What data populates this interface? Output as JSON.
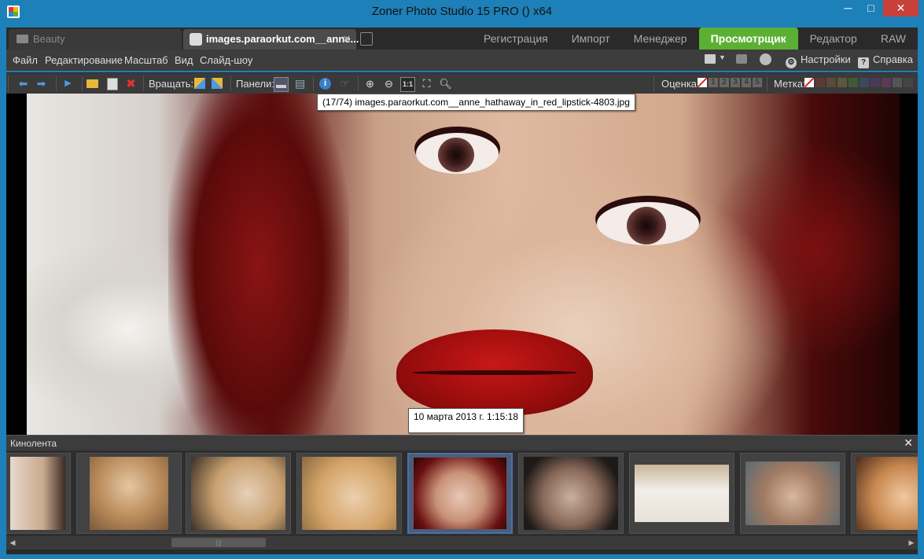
{
  "window": {
    "title": "Zoner Photo Studio 15 PRO  () x64",
    "minimize": "─",
    "maximize": "□",
    "close": "✕"
  },
  "doc_tabs": [
    {
      "label": "Beauty",
      "icon": "folder-icon"
    },
    {
      "label": "images.paraorkut.com__anne...",
      "icon": "viewer-icon",
      "close": "✕"
    }
  ],
  "mode_tabs": [
    {
      "label": "Регистрация",
      "active": false
    },
    {
      "label": "Импорт",
      "active": false
    },
    {
      "label": "Менеджер",
      "active": false
    },
    {
      "label": "Просмотрщик",
      "active": true
    },
    {
      "label": "Редактор",
      "active": false
    },
    {
      "label": "RAW",
      "active": false
    }
  ],
  "menu": [
    "Файл",
    "Редактирование",
    "Масштаб",
    "Вид",
    "Слайд-шоу"
  ],
  "menu_right": {
    "settings": "Настройки",
    "help": "Справка"
  },
  "toolbar": {
    "rotate_label": "Вращать:",
    "panels_label": "Панели:",
    "rating_label": "Оценка:",
    "rating_values": [
      "1",
      "2",
      "3",
      "4",
      "5"
    ],
    "label_label": "Метка:",
    "label_colors": [
      "#5a3a3a",
      "#5a4a3a",
      "#5a5a3a",
      "#3f5a3a",
      "#3a4a5a",
      "#4a3a5a",
      "#5a3a55",
      "#555555",
      "#454545"
    ]
  },
  "viewer": {
    "file_tooltip": "(17/74) images.paraorkut.com__anne_hathaway_in_red_lipstick-4803.jpg",
    "date_tooltip": "10 марта 2013 г.  1:15:18"
  },
  "filmstrip": {
    "title": "Кинолента",
    "close": "✕",
    "selected_index": 4,
    "thumb_count": 9
  },
  "colors": {
    "active_tab": "#5bb034",
    "titlebar": "#1e80b8",
    "close_button": "#c7403a",
    "selected_thumb_border": "#4a6fa8"
  }
}
